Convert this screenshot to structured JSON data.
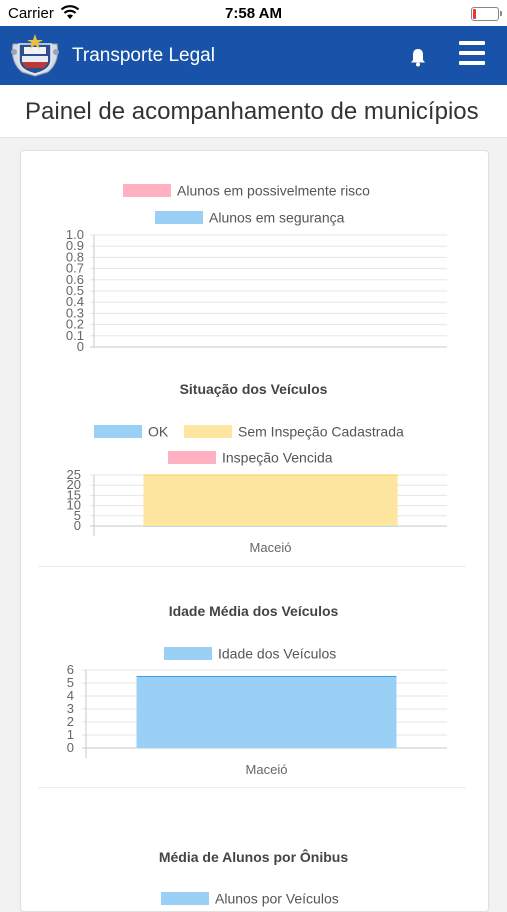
{
  "status_bar": {
    "carrier": "Carrier",
    "time": "7:58 AM"
  },
  "navbar": {
    "title": "Transporte Legal"
  },
  "page": {
    "title": "Painel de acompanhamento de municípios"
  },
  "charts": {
    "risk": {
      "legend": [
        {
          "label": "Alunos em possivelmente risco",
          "color": "#ffb1c1"
        },
        {
          "label": "Alunos em segurança",
          "color": "#9ad0f5"
        }
      ]
    },
    "vehicles_status": {
      "title": "Situação dos Veículos",
      "legend": [
        {
          "label": "OK",
          "color": "#9ad0f5"
        },
        {
          "label": "Sem Inspeção Cadastrada",
          "color": "#ffe6a0"
        },
        {
          "label": "Inspeção Vencida",
          "color": "#ffb1c1"
        }
      ]
    },
    "vehicle_age": {
      "title": "Idade Média dos Veículos",
      "legend": [
        {
          "label": "Idade dos Veículos",
          "color": "#9ad0f5"
        }
      ]
    },
    "students_per_bus": {
      "title": "Média de Alunos por Ônibus",
      "legend": [
        {
          "label": "Alunos por Veículos",
          "color": "#9ad0f5"
        }
      ]
    }
  },
  "chart_data": [
    {
      "type": "bar",
      "categories": [],
      "series": [
        {
          "name": "Alunos em possivelmente risco",
          "values": []
        },
        {
          "name": "Alunos em segurança",
          "values": []
        }
      ],
      "yticks": [
        "1.0",
        "0.9",
        "0.8",
        "0.7",
        "0.6",
        "0.5",
        "0.4",
        "0.3",
        "0.2",
        "0.1",
        "0"
      ],
      "ylim": [
        0,
        1
      ]
    },
    {
      "type": "bar",
      "title": "Situação dos Veículos",
      "categories": [
        "Maceió"
      ],
      "series": [
        {
          "name": "OK",
          "values": [
            0
          ]
        },
        {
          "name": "Sem Inspeção Cadastrada",
          "values": [
            25
          ]
        },
        {
          "name": "Inspeção Vencida",
          "values": [
            0
          ]
        }
      ],
      "yticks": [
        "25",
        "20",
        "15",
        "10",
        "5",
        "0"
      ],
      "ylim": [
        0,
        25
      ]
    },
    {
      "type": "bar",
      "title": "Idade Média dos Veículos",
      "categories": [
        "Maceió"
      ],
      "series": [
        {
          "name": "Idade dos Veículos",
          "values": [
            5.5
          ]
        }
      ],
      "yticks": [
        "6",
        "5",
        "4",
        "3",
        "2",
        "1",
        "0"
      ],
      "ylim": [
        0,
        6
      ]
    }
  ]
}
